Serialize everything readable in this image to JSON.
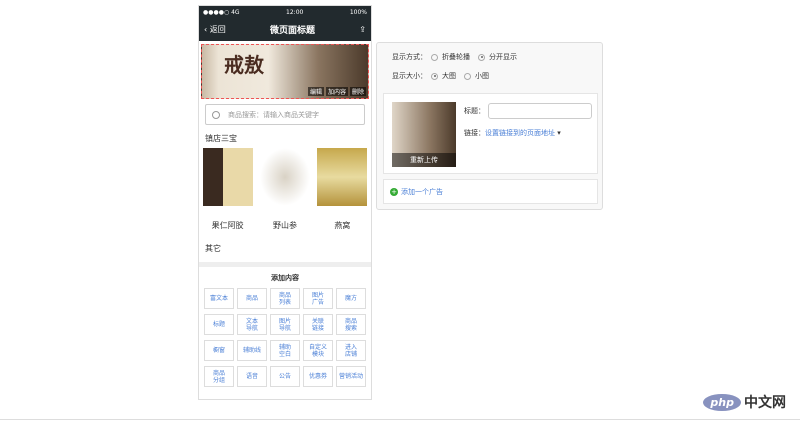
{
  "status": {
    "signal": "●●●●○ 4G",
    "time": "12:00",
    "battery": "100%"
  },
  "nav": {
    "back": "‹ 返回",
    "title": "微页面标题",
    "share": "⇪"
  },
  "banner": {
    "calligraphy": "戒敖",
    "ops": [
      "编辑",
      "加内容",
      "删除"
    ]
  },
  "search": {
    "placeholder": "商品搜索：请输入商品关键字"
  },
  "section1": "镇店三宝",
  "products": [
    "果仁阿胶",
    "野山参",
    "燕窝"
  ],
  "section2": "其它",
  "add_panel": {
    "title": "添加内容",
    "items": [
      "富文本",
      "商品",
      "商品\n列表",
      "图片\n广告",
      "魔方",
      "标题",
      "文本\n导航",
      "图片\n导航",
      "关联\n链接",
      "商品\n搜索",
      "橱窗",
      "辅助线",
      "辅助\n空白",
      "自定义\n模块",
      "进入\n店铺",
      "商品\n分组",
      "语音",
      "公告",
      "优惠券",
      "营销活动"
    ]
  },
  "editor": {
    "mode_label": "显示方式：",
    "mode_options": [
      "折叠轮播",
      "分开显示"
    ],
    "size_label": "显示大小：",
    "size_options": [
      "大图",
      "小图"
    ],
    "reupload": "重新上传",
    "title_label": "标题：",
    "link_label": "链接：",
    "link_value": "设置链接到的页面地址",
    "add_ad": "添加一个广告"
  },
  "logo": {
    "php": "php",
    "cn": "中文网"
  }
}
